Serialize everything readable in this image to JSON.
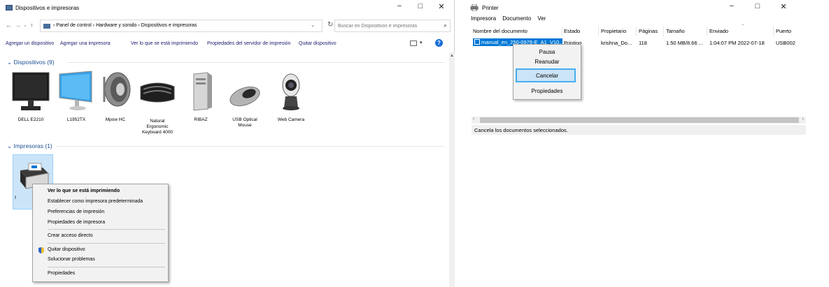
{
  "explorer": {
    "title": "Dispositivos e impresoras",
    "controls": {
      "minimize": "−",
      "maximize": "□",
      "close": "✕"
    },
    "nav": {
      "back": "←",
      "forward": "→",
      "recent": "⌄",
      "up": "↑"
    },
    "address": {
      "path": "› Panel de control  ›  Hardware y sonido  ›  Dispositivos e impresoras",
      "dropdown": "⌄",
      "refresh": "↻"
    },
    "search": {
      "placeholder": "Buscar en Dispositivos e impresoras",
      "value": "",
      "icon": "⌕"
    },
    "commands": [
      "Agregar un dispositivo",
      "Agregar una impresora",
      "Ver lo que se está imprimiendo",
      "Propiedades del servidor de impresión",
      "Quitar dispositivo"
    ],
    "view_dropdown": "▾",
    "help": "?",
    "devices_header": "⌄ Dispositivos (9)",
    "devices": [
      {
        "label": "DELL E2210"
      },
      {
        "label": "L1952TX"
      },
      {
        "label": "Mpow HC"
      },
      {
        "label": "Natural\nErgonomic\nKeyboard 4000"
      },
      {
        "label": "RIBAZ"
      },
      {
        "label": "USB Optical\nMouse"
      },
      {
        "label": "Web Camera"
      }
    ],
    "printers_header": "⌄ Impresoras (1)",
    "printer_label_initial": "I",
    "context_menu": [
      {
        "label": "Ver lo que se está imprimiendo",
        "bold": true
      },
      {
        "label": "Establecer como impresora predeterminada"
      },
      {
        "label": "Preferencias de impresión"
      },
      {
        "label": "Propiedades de impresora"
      },
      {
        "label": "Crear acceso directo"
      },
      {
        "label": "Quitar dispositivo"
      },
      {
        "label": "Solucionar problemas"
      },
      {
        "label": "Propiedades"
      }
    ]
  },
  "queue": {
    "title": "Printer",
    "controls": {
      "minimize": "−",
      "maximize": "□",
      "close": "✕"
    },
    "menu": [
      "Impresora",
      "Documento",
      "Ver"
    ],
    "columns": [
      "Nombre del documento",
      "Estado",
      "Propietario",
      "Páginas",
      "Tamaño",
      "Enviado",
      "Puerto"
    ],
    "job": {
      "name": "manual_en_250-0979-E_A1_V10...",
      "status": "Printing",
      "owner": "krishna_Do...",
      "pages": "118",
      "size": "1.50 MB/8.66 ...",
      "sent": "1:04:07 PM  2022-07-18",
      "port": "USB002"
    },
    "context_menu": [
      "Pausa",
      "Reanudar",
      "Cancelar",
      "Propiedades"
    ],
    "scroll": {
      "left": "‹",
      "right": "›"
    },
    "status": "Cancela los documentos seleccionados."
  }
}
